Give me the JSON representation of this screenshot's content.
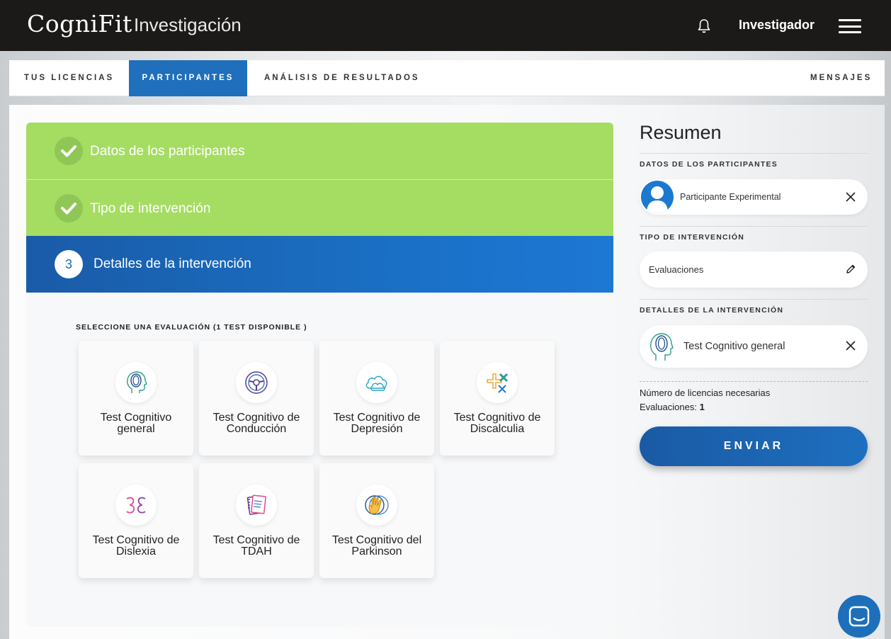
{
  "header": {
    "logo": "CogniFit",
    "logo_sub": "Investigación",
    "user": "Investigador"
  },
  "tabs": [
    {
      "label": "TUS LICENCIAS",
      "active": false
    },
    {
      "label": "PARTICIPANTES",
      "active": true
    },
    {
      "label": "ANÁLISIS DE RESULTADOS",
      "active": false
    },
    {
      "label": "MENSAJES",
      "active": false
    }
  ],
  "steps": [
    {
      "title": "Datos de los participantes",
      "status": "done"
    },
    {
      "title": "Tipo de intervención",
      "status": "done"
    },
    {
      "number": "3",
      "title": "Detalles de la intervención",
      "status": "current"
    }
  ],
  "evaluation": {
    "select_label": "SELECCIONE UNA EVALUACIÓN (1 TEST DISPONIBLE )",
    "tests": [
      {
        "line1": "Test Cognitivo",
        "line2": "general",
        "icon": "head-brain-icon"
      },
      {
        "line1": "Test Cognitivo de",
        "line2": "Conducción",
        "icon": "steering-wheel-icon"
      },
      {
        "line1": "Test Cognitivo de",
        "line2": "Depresión",
        "icon": "cloud-icon"
      },
      {
        "line1": "Test Cognitivo de",
        "line2": "Discalculia",
        "icon": "math-symbols-icon"
      },
      {
        "line1": "Test Cognitivo de",
        "line2": "Dislexia",
        "icon": "mirrored-letters-icon"
      },
      {
        "line1": "Test Cognitivo de",
        "line2": "TDAH",
        "icon": "notebook-icon"
      },
      {
        "line1": "Test Cognitivo del",
        "line2": "Parkinson",
        "icon": "hand-icon"
      }
    ]
  },
  "summary": {
    "title": "Resumen",
    "participants_label": "DATOS DE LOS PARTICIPANTES",
    "participant": "Participante Experimental",
    "intervention_type_label": "TIPO DE INTERVENCIÓN",
    "intervention_type": "Evaluaciones",
    "details_label": "DETALLES DE LA INTERVENCIÓN",
    "details": "Test Cognitivo general",
    "licenses_label": "Número de licencias necesarias",
    "evaluations_label": "Evaluaciones:",
    "evaluations_count": "1",
    "send_label": "ENVIAR"
  }
}
